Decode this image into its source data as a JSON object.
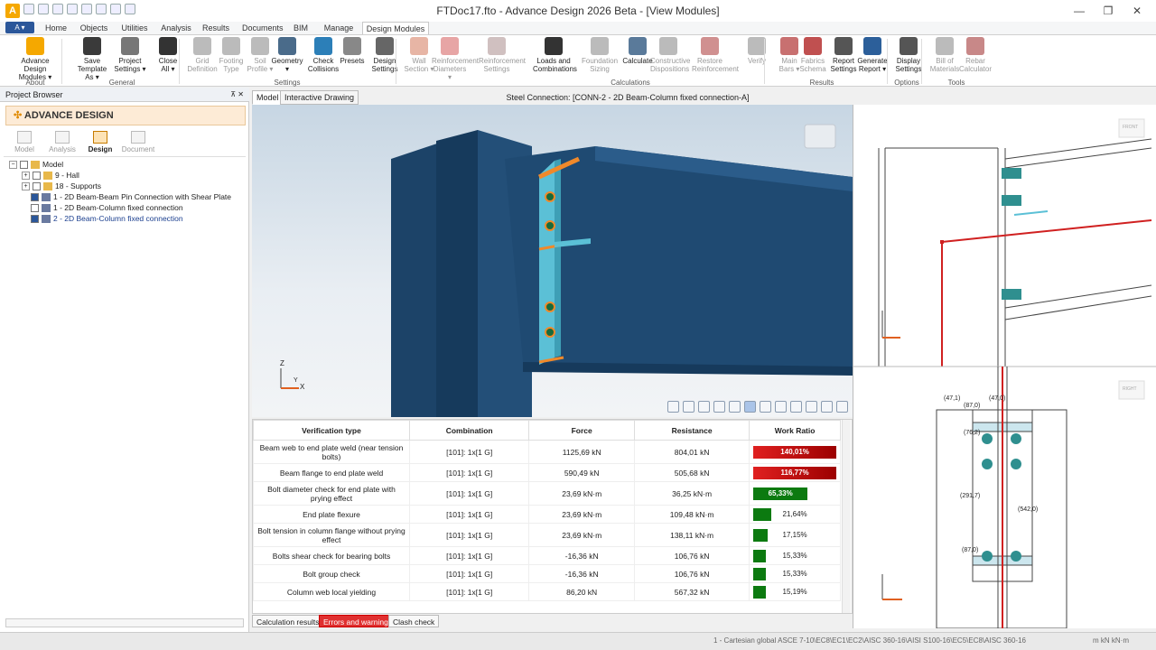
{
  "window": {
    "title": "FTDoc17.fto - Advance Design 2026 Beta - [View Modules]",
    "min": "—",
    "max": "❐",
    "close": "✕"
  },
  "appmenu": {
    "label": "A ▾"
  },
  "tabs": [
    "Home",
    "Objects",
    "Utilities",
    "Analysis",
    "Results",
    "Documents",
    "BIM",
    "Manage",
    "Design Modules"
  ],
  "ribbon": {
    "buttons": [
      {
        "l1": "Advance Design",
        "l2": "Modules ▾",
        "color": "#f5a800",
        "dis": false
      },
      {
        "l1": "Save",
        "l2": "Template As ▾",
        "color": "#3a3a3a",
        "dis": false
      },
      {
        "l1": "Project",
        "l2": "Settings ▾",
        "color": "#777777",
        "dis": false
      },
      {
        "l1": "Close",
        "l2": "All ▾",
        "color": "#333333",
        "dis": false
      },
      {
        "l1": "Grid",
        "l2": "Definition",
        "color": "#bbbbbb",
        "dis": true
      },
      {
        "l1": "Footing",
        "l2": "Type",
        "color": "#bbbbbb",
        "dis": true
      },
      {
        "l1": "Soil",
        "l2": "Profile ▾",
        "color": "#bbbbbb",
        "dis": true
      },
      {
        "l1": "Geometry",
        "l2": "▾",
        "color": "#4a6b8a",
        "dis": false
      },
      {
        "l1": "Check",
        "l2": "Collisions",
        "color": "#2c7fb8",
        "dis": false
      },
      {
        "l1": "Presets",
        "l2": "",
        "color": "#888888",
        "dis": false
      },
      {
        "l1": "Design",
        "l2": "Settings",
        "color": "#666666",
        "dis": false
      },
      {
        "l1": "Wall",
        "l2": "Section ▾",
        "color": "#e7b5a5",
        "dis": true
      },
      {
        "l1": "Reinforcement",
        "l2": "Diameters ▾",
        "color": "#e7a5a5",
        "dis": true
      },
      {
        "l1": "Reinforcement",
        "l2": "Settings",
        "color": "#d0c0c0",
        "dis": true
      },
      {
        "l1": "Loads and",
        "l2": "Combinations",
        "color": "#333333",
        "dis": false
      },
      {
        "l1": "Foundation",
        "l2": "Sizing",
        "color": "#bbbbbb",
        "dis": true
      },
      {
        "l1": "Calculate",
        "l2": "",
        "color": "#5a7a9a",
        "dis": false
      },
      {
        "l1": "Constructive",
        "l2": "Dispositions",
        "color": "#bbbbbb",
        "dis": true
      },
      {
        "l1": "Restore",
        "l2": "Reinforcement",
        "color": "#d09090",
        "dis": true
      },
      {
        "l1": "Verify",
        "l2": "",
        "color": "#bbbbbb",
        "dis": true
      },
      {
        "l1": "Main",
        "l2": "Bars ▾",
        "color": "#c87070",
        "dis": true
      },
      {
        "l1": "Fabrics",
        "l2": "Schema",
        "color": "#c05050",
        "dis": true
      },
      {
        "l1": "Report",
        "l2": "Settings",
        "color": "#555555",
        "dis": false
      },
      {
        "l1": "Generate",
        "l2": "Report ▾",
        "color": "#2c5f9a",
        "dis": false
      },
      {
        "l1": "Display",
        "l2": "Settings",
        "color": "#555555",
        "dis": false
      },
      {
        "l1": "Bill of",
        "l2": "Materials",
        "color": "#bbbbbb",
        "dis": true
      },
      {
        "l1": "Rebar",
        "l2": "Calculator",
        "color": "#c88888",
        "dis": true
      }
    ],
    "groups": [
      "About",
      "General",
      "Settings",
      "Calculations",
      "Results",
      "Options",
      "Tools"
    ]
  },
  "browser": {
    "title": "Project Browser",
    "pin": "⊼ ✕",
    "brand": "ADVANCE DESIGN",
    "tabs": [
      "Model",
      "Analysis",
      "Design",
      "Document"
    ],
    "tree": [
      {
        "label": "Model",
        "toggle": "−",
        "check": false,
        "type": "root"
      },
      {
        "label": "9 - Hall",
        "toggle": "+",
        "check": false,
        "type": "folder"
      },
      {
        "label": "18 - Supports",
        "toggle": "+",
        "check": false,
        "type": "folder"
      },
      {
        "label": "1 - 2D Beam-Beam Pin Connection with Shear Plate",
        "toggle": "",
        "check": true,
        "type": "conn"
      },
      {
        "label": "1 - 2D Beam-Column fixed connection",
        "toggle": "",
        "check": false,
        "type": "conn"
      },
      {
        "label": "2 - 2D Beam-Column fixed connection",
        "toggle": "",
        "check": true,
        "type": "conn"
      }
    ]
  },
  "view": {
    "tab_model": "Model",
    "tab_interactive": "Interactive Drawing",
    "connection_title": "Steel Connection: [CONN-2 - 2D Beam-Column fixed connection-A]",
    "axis_z": "Z",
    "axis_x": "X",
    "axis_y": "Y"
  },
  "table": {
    "headers": [
      "Verification type",
      "Combination",
      "Force",
      "Resistance",
      "Work Ratio"
    ],
    "rows": [
      {
        "type": "Beam web to end plate weld (near tension bolts)",
        "comb": "[101]: 1x[1 G]",
        "force": "1125,69 kN",
        "res": "804,01 kN",
        "ratio": "140,01%",
        "pct": 140.01
      },
      {
        "type": "Beam flange to end plate weld",
        "comb": "[101]: 1x[1 G]",
        "force": "590,49 kN",
        "res": "505,68 kN",
        "ratio": "116,77%",
        "pct": 116.77
      },
      {
        "type": "Bolt diameter check for end plate with prying effect",
        "comb": "[101]: 1x[1 G]",
        "force": "23,69 kN·m",
        "res": "36,25 kN·m",
        "ratio": "65,33%",
        "pct": 65.33
      },
      {
        "type": "End plate flexure",
        "comb": "[101]: 1x[1 G]",
        "force": "23,69 kN·m",
        "res": "109,48 kN·m",
        "ratio": "21,64%",
        "pct": 21.64
      },
      {
        "type": "Bolt tension in column flange without prying effect",
        "comb": "[101]: 1x[1 G]",
        "force": "23,69 kN·m",
        "res": "138,11 kN·m",
        "ratio": "17,15%",
        "pct": 17.15
      },
      {
        "type": "Bolts shear check for bearing bolts",
        "comb": "[101]: 1x[1 G]",
        "force": "-16,36 kN",
        "res": "106,76 kN",
        "ratio": "15,33%",
        "pct": 15.33
      },
      {
        "type": "Bolt group check",
        "comb": "[101]: 1x[1 G]",
        "force": "-16,36 kN",
        "res": "106,76 kN",
        "ratio": "15,33%",
        "pct": 15.33
      },
      {
        "type": "Column web local yielding",
        "comb": "[101]: 1x[1 G]",
        "force": "86,20 kN",
        "res": "567,32 kN",
        "ratio": "15,19%",
        "pct": 15.19
      }
    ]
  },
  "bottom_tabs": [
    "Calculation results",
    "Errors and warnings",
    "Clash check"
  ],
  "drawing": {
    "dims": [
      "(47,1)",
      "(87,0)",
      "(76,2)",
      "(291,7)",
      "(542,0)",
      "(87,0)",
      "(47,0)"
    ],
    "front_label": "FRONT",
    "right_label": "RIGHT"
  },
  "status": {
    "text": "1 - Cartesian global  ASCE 7-10\\EC8\\EC1\\EC2\\AISC 360-16\\AISI S100-16\\EC5\\EC8\\AISC 360-16",
    "units": "m  kN  kN·m"
  },
  "colors": {
    "danger": "#e02020",
    "ok": "#0c7a10",
    "steel": "#1f4a72",
    "plate": "#5bc0d6",
    "weld": "#f0892a"
  }
}
